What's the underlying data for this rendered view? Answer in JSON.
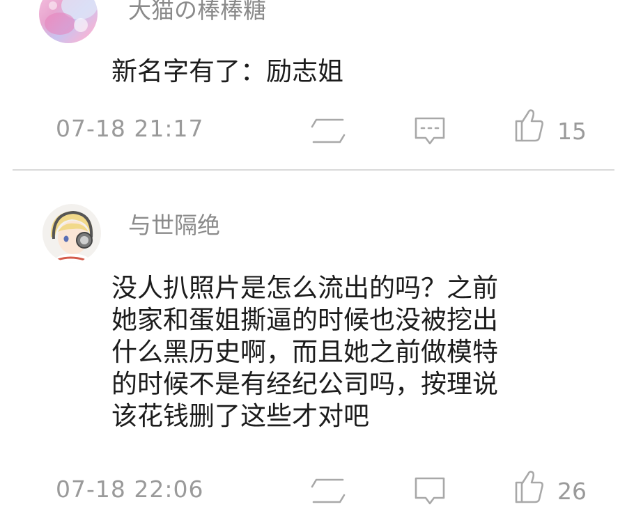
{
  "comments": [
    {
      "username": "大猫の棒棒糖",
      "text_lines": [
        "新名字有了：励志姐"
      ],
      "timestamp": "07-18  21:17",
      "likes": "15",
      "avatar": "pink-holographic-avatar"
    },
    {
      "username": "与世隔绝",
      "text_lines": [
        "没人扒照片是怎么流出的吗？之前",
        "她家和蛋姐撕逼的时候也没被挖出",
        "什么黑历史啊，而且她之前做模特",
        "的时候不是有经纪公司吗，按理说",
        "该花钱删了这些才对吧"
      ],
      "timestamp": "07-18  22:06",
      "likes": "26",
      "avatar": "anime-boy-headphones-avatar"
    }
  ],
  "icons": {
    "repost": "repost-icon",
    "reply": "comment-icon",
    "like": "thumbs-up-icon"
  },
  "colors": {
    "text": "#1c1c1c",
    "secondary": "#9a9a9a",
    "icon": "#a8a8a8",
    "divider": "#d9d9d9"
  }
}
